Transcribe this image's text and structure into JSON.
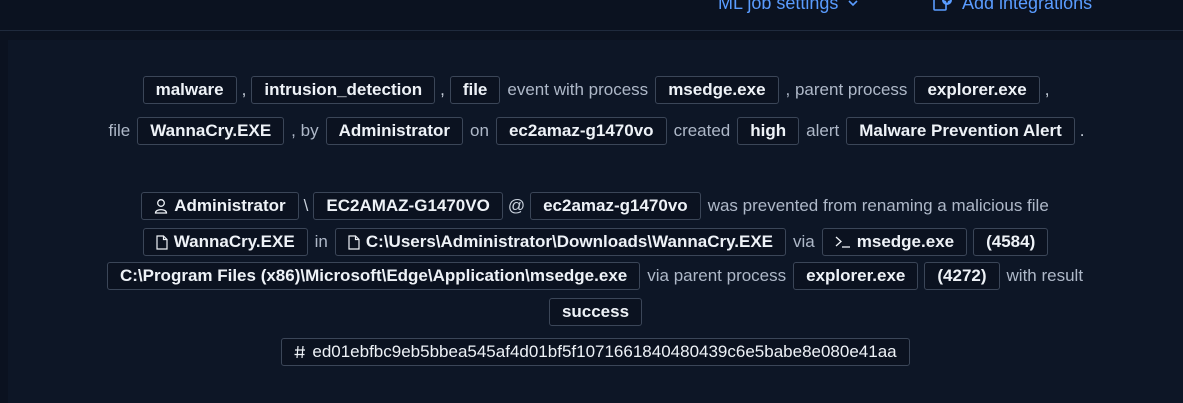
{
  "topbar": {
    "ml_job_settings": "ML job settings",
    "add_integrations": "Add integrations"
  },
  "summary": {
    "cat1": "malware",
    "cat2": "intrusion_detection",
    "cat3": "file",
    "event_with_process": "event with process",
    "process": "msedge.exe",
    "parent_process_text": ", parent process",
    "parent_process": "explorer.exe",
    "file_text": "file",
    "file": "WannaCry.EXE",
    "by_text": ", by",
    "user": "Administrator",
    "on_text": "on",
    "host": "ec2amaz-g1470vo",
    "created_text": "created",
    "severity": "high",
    "alert_text": "alert",
    "rule_name": "Malware Prevention Alert",
    "comma": ",",
    "period": "."
  },
  "detail": {
    "user": "Administrator",
    "backslash": "\\",
    "domain": "EC2AMAZ-G1470VO",
    "at": "@",
    "host": "ec2amaz-g1470vo",
    "action_text": "was prevented from renaming a malicious file",
    "file_name": "WannaCry.EXE",
    "in_text": "in",
    "file_path": "C:\\Users\\Administrator\\Downloads\\WannaCry.EXE",
    "via_text": "via",
    "process_name": "msedge.exe",
    "pid": "(4584)",
    "process_path": "C:\\Program Files (x86)\\Microsoft\\Edge\\Application\\msedge.exe",
    "via_parent_text": "via parent process",
    "parent_name": "explorer.exe",
    "parent_pid": "(4272)",
    "with_result_text": "with result",
    "result": "success",
    "hash": "ed01ebfbc9eb5bbea545af4d01bf5f1071661840480439c6e5babe8e080e41aa"
  },
  "colors": {
    "background": "#0b1220",
    "panel": "#0d1626",
    "link": "#5a9cff",
    "badge_border": "#3b4658"
  },
  "icons": [
    "chevron-down-icon",
    "add-integration-icon",
    "user-icon",
    "file-icon",
    "terminal-icon",
    "hash-icon"
  ]
}
